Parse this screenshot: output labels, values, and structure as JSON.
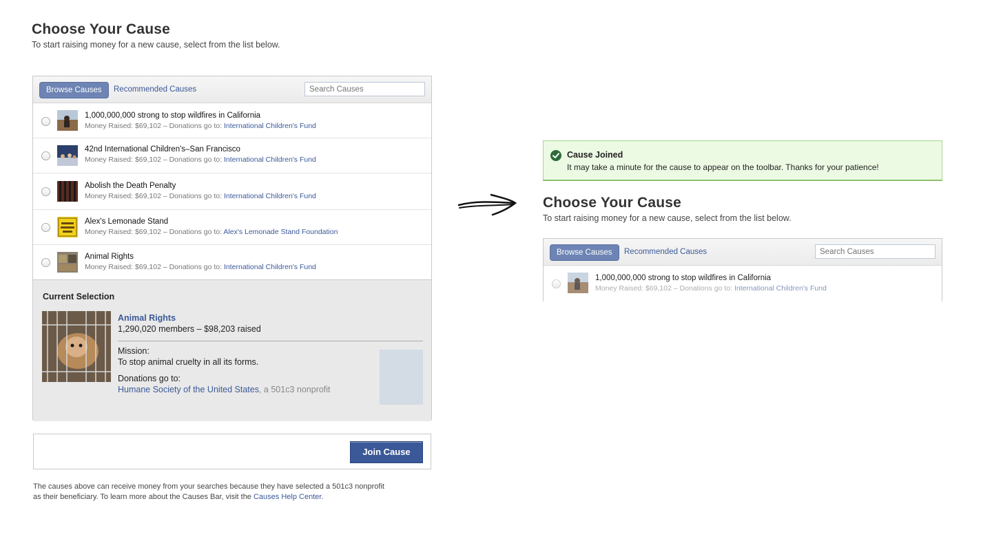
{
  "left": {
    "title": "Choose Your Cause",
    "subtitle": "To start raising money for a new cause, select from the list below.",
    "tabs": {
      "browse": "Browse Causes",
      "recommended": "Recommended Causes"
    },
    "search_placeholder": "Search Causes",
    "causes": [
      {
        "title": "1,000,000,000 strong to stop wildfires in California",
        "raised": "Money Raised: $69,102 – Donations go to: ",
        "beneficiary": "International Children's Fund",
        "thumb": "wildfire"
      },
      {
        "title": "42nd International Children's–San Francisco",
        "raised": "Money Raised: $69,102 – Donations go to: ",
        "beneficiary": "International Children's Fund",
        "thumb": "crowd"
      },
      {
        "title": "Abolish the Death Penalty",
        "raised": "Money Raised: $69,102 – Donations go to: ",
        "beneficiary": "International Children's Fund",
        "thumb": "bars"
      },
      {
        "title": "Alex's Lemonade Stand",
        "raised": "Money Raised: $69,102 – Donations go to: ",
        "beneficiary": "Alex's Lemonade Stand Foundation",
        "thumb": "lemonade"
      },
      {
        "title": "Animal Rights",
        "raised": "Money Raised: $69,102 – Donations go to: ",
        "beneficiary": "International Children's Fund",
        "thumb": "animal"
      }
    ],
    "current": {
      "heading": "Current Selection",
      "name": "Animal Rights",
      "stats": "1,290,020 members – $98,203 raised",
      "mission_label": "Mission:",
      "mission": "To stop animal cruelty in all its forms.",
      "donations_label": "Donations go to:",
      "org": "Humane Society of the United States",
      "org_suffix": ", a 501c3 nonprofit"
    },
    "join_label": "Join Cause",
    "footer_text": "The causes above can receive money from your searches because they have selected a 501c3 nonprofit as their beneficiary. To learn more about the Causes Bar, visit the ",
    "footer_link": "Causes Help Center",
    "footer_end": "."
  },
  "right": {
    "notice_title": "Cause Joined",
    "notice_text": "It may take a minute for the cause to appear on the toolbar. Thanks for your patience!",
    "title": "Choose Your Cause",
    "subtitle": "To start raising money for a new cause, select from the list below.",
    "tabs": {
      "browse": "Browse Causes",
      "recommended": "Recommended Causes"
    },
    "search_placeholder": "Search Causes",
    "cause": {
      "title": "1,000,000,000 strong to stop wildfires in California",
      "raised": "Money Raised: $69,102 – Donations go to: ",
      "beneficiary": "International Children's Fund"
    }
  },
  "colors": {
    "link": "#3b5998",
    "tab_active": "#6d84b4",
    "success_bg": "#ecfae3",
    "success_icon": "#2e6b3a"
  }
}
